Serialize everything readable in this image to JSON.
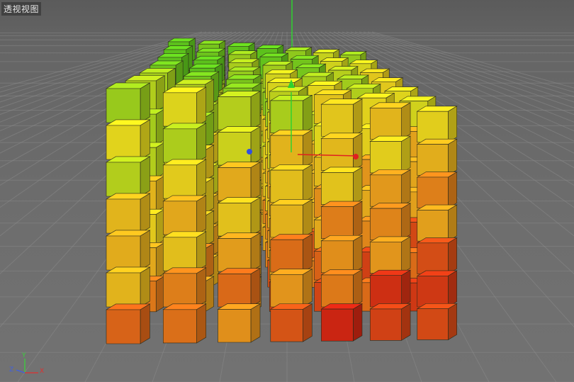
{
  "viewport": {
    "label": "透视视图",
    "background": "#6b6b6b",
    "grid_color": "#8a8a8a"
  },
  "scene": {
    "object": "cube-grid",
    "grid_size": [
      7,
      7,
      7
    ],
    "gradient_colors": [
      "#64d21e",
      "#f5e61e",
      "#f5a01e",
      "#dc2814"
    ],
    "y_axis_color": "#2fd12f",
    "x_axis_color": "#e02020",
    "z_axis_color": "#3050e0"
  },
  "axis_gizmo": {
    "x_label": "X",
    "y_label": "Y",
    "z_label": "Z",
    "x_color": "#e03030",
    "y_color": "#3bd03b",
    "z_color": "#4060e0"
  }
}
